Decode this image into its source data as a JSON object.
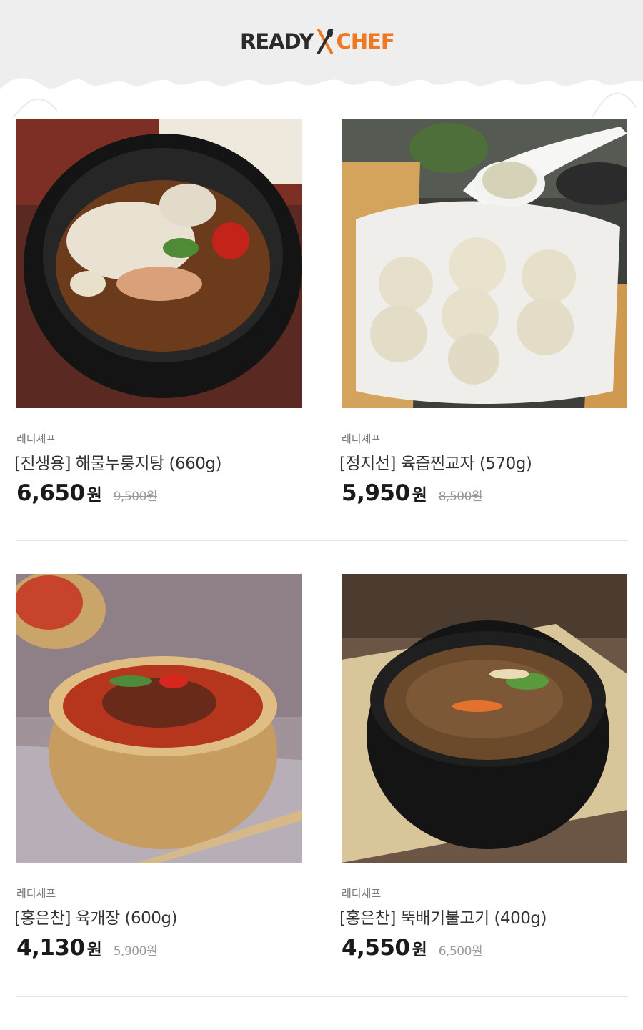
{
  "header": {
    "logo_ready": "READY",
    "logo_chef": "CHEF"
  },
  "products": [
    {
      "brand": "레디셰프",
      "title": "[진생용] 해물누룽지탕 (660g)",
      "price": "6,650",
      "won": "원",
      "original_price": "9,500원",
      "image_icon": "seafood-nurungji-stew-image"
    },
    {
      "brand": "레디셰프",
      "title": "[정지선] 육즙찐교자 (570g)",
      "price": "5,950",
      "won": "원",
      "original_price": "8,500원",
      "image_icon": "steamed-dumplings-image"
    },
    {
      "brand": "레디셰프",
      "title": "[홍은찬] 육개장 (600g)",
      "price": "4,130",
      "won": "원",
      "original_price": "5,900원",
      "image_icon": "yukgaejang-soup-image"
    },
    {
      "brand": "레디셰프",
      "title": "[홍은찬] 뚝배기불고기 (400g)",
      "price": "4,550",
      "won": "원",
      "original_price": "6,500원",
      "image_icon": "ttukbaegi-bulgogi-image"
    }
  ],
  "colors": {
    "header_bg": "#eeeeee",
    "logo_dark": "#2b2b2b",
    "logo_accent": "#f07822",
    "price": "#1a1a1a",
    "original_price": "#9a9a9a"
  }
}
